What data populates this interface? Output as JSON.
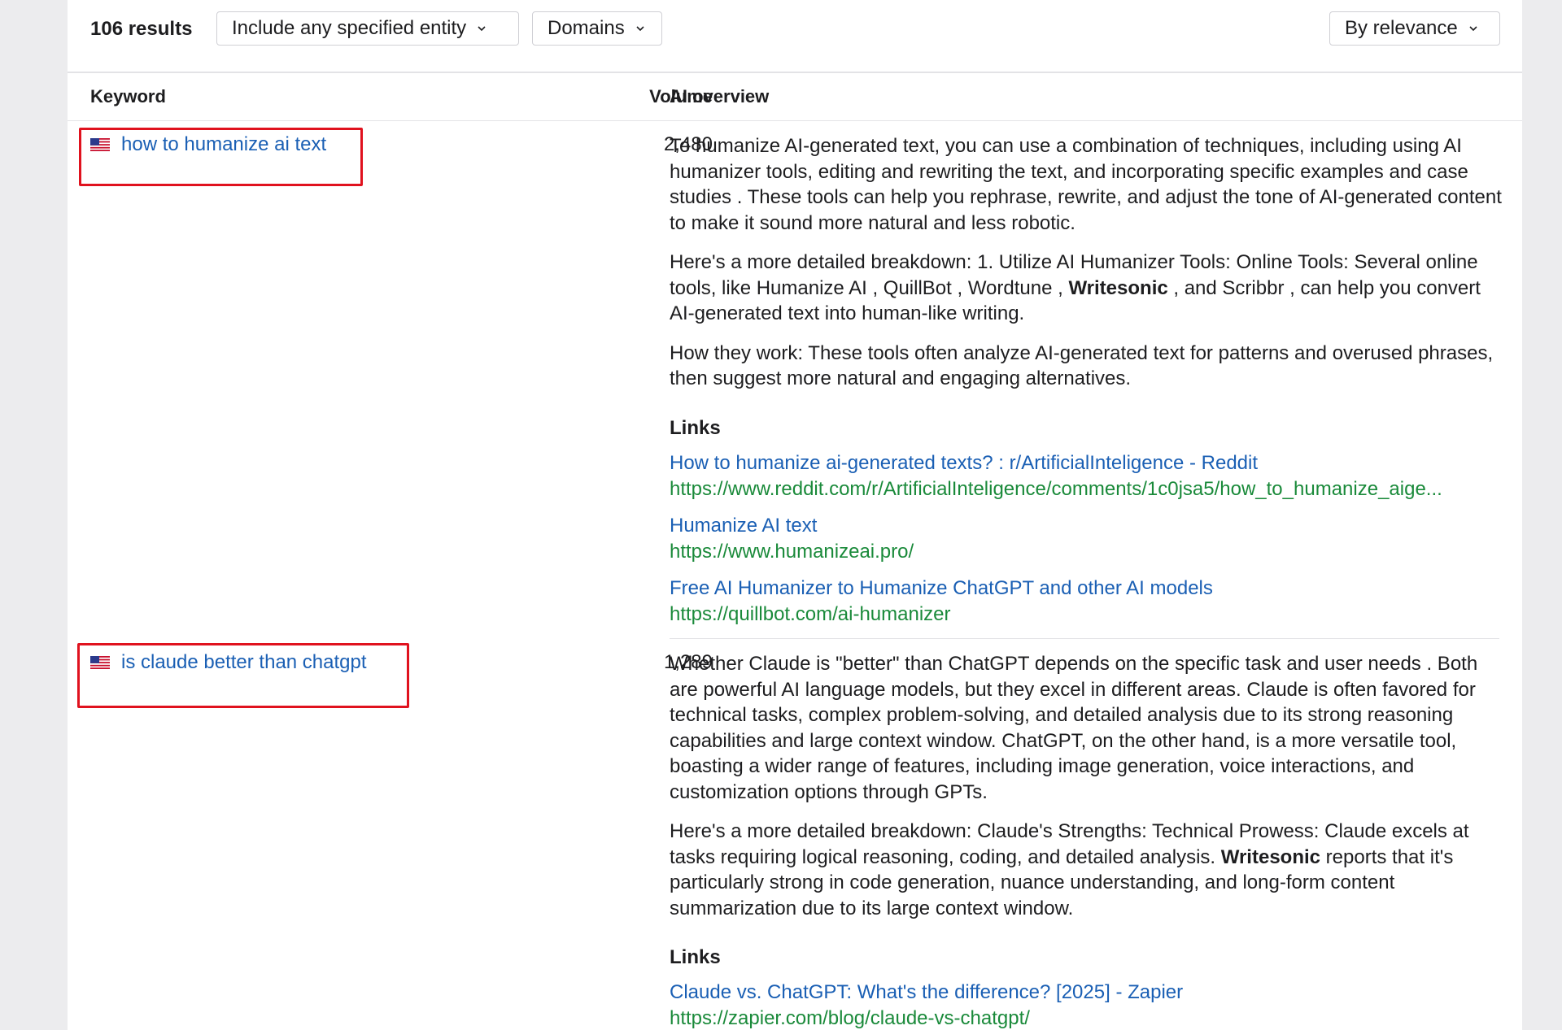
{
  "toolbar": {
    "results_count": "106 results",
    "entity_filter": "Include any specified entity",
    "domains_filter": "Domains",
    "sort": "By relevance"
  },
  "table": {
    "headers": {
      "keyword": "Keyword",
      "volume": "Volume",
      "ai_overview": "AI overview"
    },
    "rows": [
      {
        "keyword": "how to humanize ai text",
        "country_flag": "us-flag-icon",
        "volume": "2,480",
        "paragraphs": [
          "To humanize AI-generated text, you can use a combination of techniques, including using AI humanizer tools, editing and rewriting the text, and incorporating specific examples and case studies . These tools can help you rephrase, rewrite, and adjust the tone of AI-generated content to make it sound more natural and less robotic.",
          "How they work: These tools often analyze AI-generated text for patterns and overused phrases, then suggest more natural and engaging alternatives."
        ],
        "p2_before": "Here's a more detailed breakdown: 1. Utilize AI Humanizer Tools: Online Tools: Several online tools, like Humanize AI , QuillBot , Wordtune ,",
        "p2_bold": "Writesonic",
        "p2_after": ", and Scribbr , can help you convert AI-generated text into human-like writing.",
        "links_label": "Links",
        "links": [
          {
            "title": "How to humanize ai-generated texts? : r/ArtificialInteligence - Reddit",
            "url": "https://www.reddit.com/r/ArtificialInteligence/comments/1c0jsa5/how_to_humanize_aige..."
          },
          {
            "title": "Humanize AI text",
            "url": "https://www.humanizeai.pro/"
          },
          {
            "title": "Free AI Humanizer to Humanize ChatGPT and other AI models",
            "url": "https://quillbot.com/ai-humanizer"
          }
        ]
      },
      {
        "keyword": "is claude better than chatgpt",
        "country_flag": "us-flag-icon",
        "volume": "1,289",
        "paragraphs": [
          "Whether Claude is \"better\" than ChatGPT depends on the specific task and user needs . Both are powerful AI language models, but they excel in different areas. Claude is often favored for technical tasks, complex problem-solving, and detailed analysis due to its strong reasoning capabilities and large context window. ChatGPT, on the other hand, is a more versatile tool, boasting a wider range of features, including image generation, voice interactions, and customization options through GPTs."
        ],
        "p2_before": "Here's a more detailed breakdown: Claude's Strengths: Technical Prowess: Claude excels at tasks requiring logical reasoning, coding, and detailed analysis.",
        "p2_bold": "Writesonic",
        "p2_after": "reports that it's particularly strong in code generation, nuance understanding, and long-form content summarization due to its large context window.",
        "links_label": "Links",
        "links": [
          {
            "title": "Claude vs. ChatGPT: What's the difference? [2025] - Zapier",
            "url": "https://zapier.com/blog/claude-vs-chatgpt/"
          }
        ]
      }
    ]
  },
  "colors": {
    "link_blue": "#1a5fb4",
    "url_green": "#1a8a3a",
    "highlight_red": "#e0121e"
  }
}
